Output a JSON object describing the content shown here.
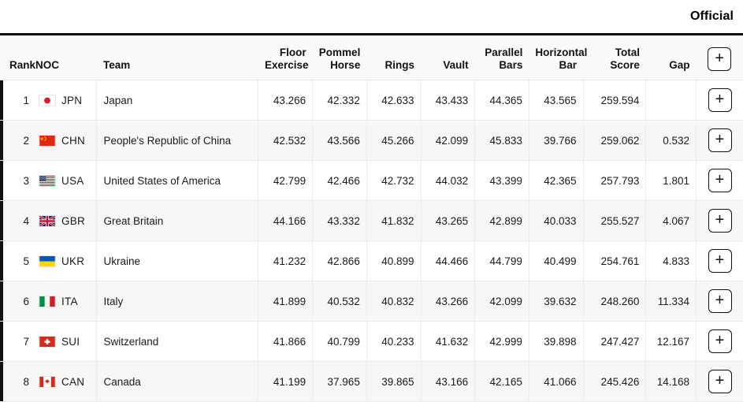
{
  "header": {
    "status_label": "Official"
  },
  "table": {
    "columns": [
      {
        "key": "rank",
        "label": "Rank"
      },
      {
        "key": "noc",
        "label": "NOC"
      },
      {
        "key": "team",
        "label": "Team"
      },
      {
        "key": "floor",
        "label": "Floor\nExercise"
      },
      {
        "key": "pommel",
        "label": "Pommel\nHorse"
      },
      {
        "key": "rings",
        "label": "Rings"
      },
      {
        "key": "vault",
        "label": "Vault"
      },
      {
        "key": "pbars",
        "label": "Parallel\nBars"
      },
      {
        "key": "hbar",
        "label": "Horizontal\nBar"
      },
      {
        "key": "total",
        "label": "Total\nScore"
      },
      {
        "key": "gap",
        "label": "Gap"
      },
      {
        "key": "action",
        "label": "+"
      }
    ],
    "column_labels": {
      "rank": "Rank",
      "noc": "NOC",
      "team": "Team",
      "floor_line1": "Floor",
      "floor_line2": "Exercise",
      "pommel_line1": "Pommel",
      "pommel_line2": "Horse",
      "rings": "Rings",
      "vault": "Vault",
      "pbars_line1": "Parallel",
      "pbars_line2": "Bars",
      "hbar_line1": "Horizontal",
      "hbar_line2": "Bar",
      "total_line1": "Total",
      "total_line2": "Score",
      "gap": "Gap",
      "expand": "+"
    },
    "rows": [
      {
        "rank": "1",
        "noc": "JPN",
        "flag": "flag-jpn",
        "team": "Japan",
        "floor": "43.266",
        "pommel": "42.332",
        "rings": "42.633",
        "vault": "43.433",
        "pbars": "44.365",
        "hbar": "43.565",
        "total": "259.594",
        "gap": "",
        "expand": "+"
      },
      {
        "rank": "2",
        "noc": "CHN",
        "flag": "flag-chn",
        "team": "People's Republic of China",
        "floor": "42.532",
        "pommel": "43.566",
        "rings": "45.266",
        "vault": "42.099",
        "pbars": "45.833",
        "hbar": "39.766",
        "total": "259.062",
        "gap": "0.532",
        "expand": "+"
      },
      {
        "rank": "3",
        "noc": "USA",
        "flag": "flag-usa",
        "team": "United States of America",
        "floor": "42.799",
        "pommel": "42.466",
        "rings": "42.732",
        "vault": "44.032",
        "pbars": "43.399",
        "hbar": "42.365",
        "total": "257.793",
        "gap": "1.801",
        "expand": "+"
      },
      {
        "rank": "4",
        "noc": "GBR",
        "flag": "flag-gbr",
        "team": "Great Britain",
        "floor": "44.166",
        "pommel": "43.332",
        "rings": "41.832",
        "vault": "43.265",
        "pbars": "42.899",
        "hbar": "40.033",
        "total": "255.527",
        "gap": "4.067",
        "expand": "+"
      },
      {
        "rank": "5",
        "noc": "UKR",
        "flag": "flag-ukr",
        "team": "Ukraine",
        "floor": "41.232",
        "pommel": "42.866",
        "rings": "40.899",
        "vault": "44.466",
        "pbars": "44.799",
        "hbar": "40.499",
        "total": "254.761",
        "gap": "4.833",
        "expand": "+"
      },
      {
        "rank": "6",
        "noc": "ITA",
        "flag": "flag-ita",
        "team": "Italy",
        "floor": "41.899",
        "pommel": "40.532",
        "rings": "40.832",
        "vault": "43.266",
        "pbars": "42.099",
        "hbar": "39.632",
        "total": "248.260",
        "gap": "11.334",
        "expand": "+"
      },
      {
        "rank": "7",
        "noc": "SUI",
        "flag": "flag-sui",
        "team": "Switzerland",
        "floor": "41.866",
        "pommel": "40.799",
        "rings": "40.233",
        "vault": "41.632",
        "pbars": "42.999",
        "hbar": "39.898",
        "total": "247.427",
        "gap": "12.167",
        "expand": "+"
      },
      {
        "rank": "8",
        "noc": "CAN",
        "flag": "flag-can",
        "team": "Canada",
        "floor": "41.199",
        "pommel": "37.965",
        "rings": "39.865",
        "vault": "43.166",
        "pbars": "42.165",
        "hbar": "41.066",
        "total": "245.426",
        "gap": "14.168",
        "expand": "+"
      }
    ]
  },
  "colors": {
    "accent_bar": "#111111",
    "header_rule": "#111111",
    "row_alt": "#f7f7f7",
    "text": "#1a1a1a"
  }
}
